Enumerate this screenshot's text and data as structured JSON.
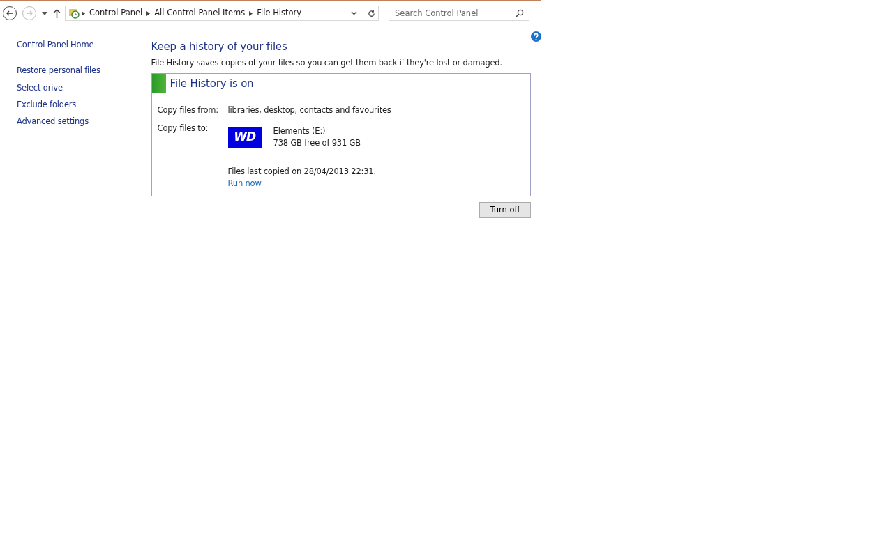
{
  "address_bar": {
    "breadcrumbs": [
      "Control Panel",
      "All Control Panel Items",
      "File History"
    ],
    "back_disabled": false,
    "forward_disabled": true
  },
  "search": {
    "placeholder": "Search Control Panel"
  },
  "sidebar": {
    "items": [
      {
        "label": "Control Panel Home",
        "kind": "home"
      },
      {
        "label": "Restore personal files",
        "kind": "task"
      },
      {
        "label": "Select drive",
        "kind": "task"
      },
      {
        "label": "Exclude folders",
        "kind": "task"
      },
      {
        "label": "Advanced settings",
        "kind": "task"
      }
    ]
  },
  "heading": "Keep a history of your files",
  "description": "File History saves copies of your files so you can get them back if they're lost or damaged.",
  "status": {
    "title": "File History is on",
    "on": true
  },
  "details": {
    "copy_from_label": "Copy files from:",
    "copy_from": "libraries, desktop, contacts and favourites",
    "copy_to_label": "Copy files to:",
    "drive": {
      "logo_text": "WD",
      "name": "Elements (E:)",
      "space": "738 GB free of 931 GB"
    },
    "last_copied": "Files last copied on 28/04/2013 22:31.",
    "run_now": "Run now"
  },
  "buttons": [
    "Turn off"
  ]
}
